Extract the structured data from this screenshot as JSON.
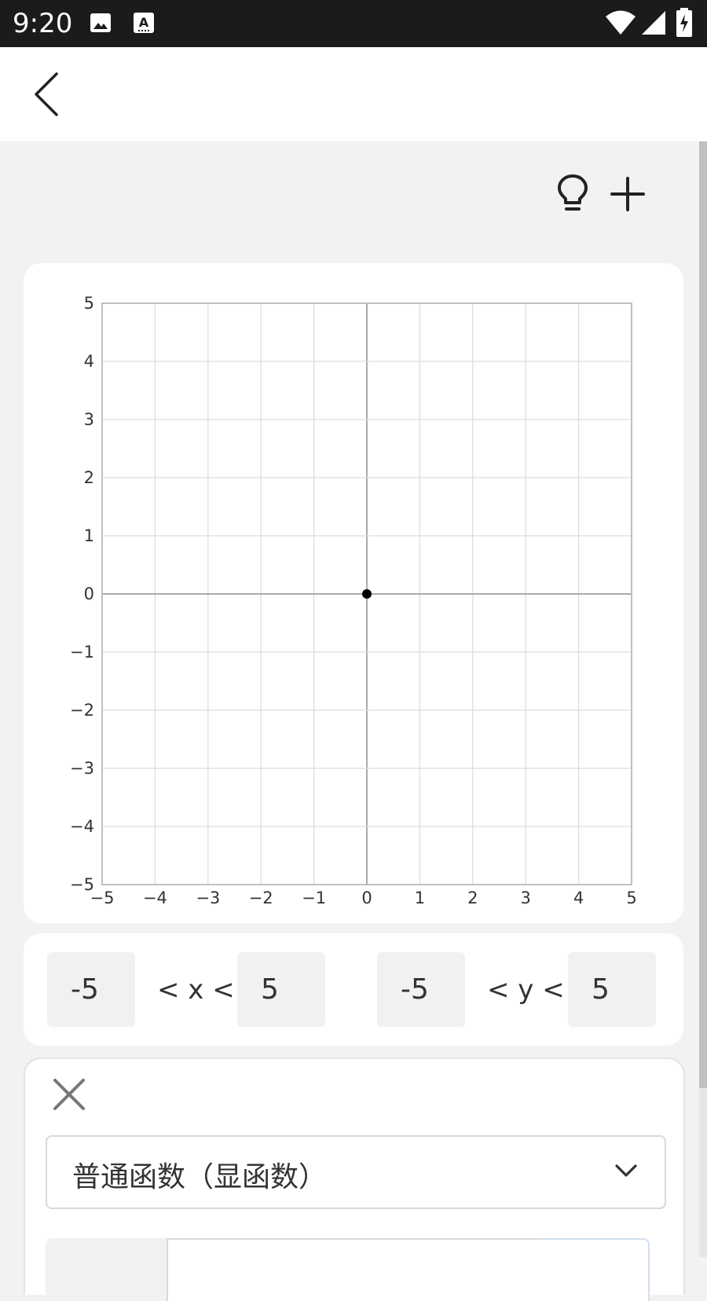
{
  "status_bar": {
    "time": "9:20",
    "icons": [
      "image-icon",
      "text-recognition-icon",
      "wifi-icon",
      "cellular-signal-icon",
      "battery-charging-icon"
    ]
  },
  "app_bar": {
    "back_icon": "chevron-left-icon"
  },
  "toolbar": {
    "hint_icon": "lightbulb-icon",
    "add_icon": "plus-icon"
  },
  "graph": {
    "chart_data": {
      "type": "scatter",
      "title": "",
      "xlabel": "",
      "ylabel": "",
      "xlim": [
        -5,
        5
      ],
      "ylim": [
        -5,
        5
      ],
      "x_ticks": [
        "−5",
        "−4",
        "−3",
        "−2",
        "−1",
        "0",
        "1",
        "2",
        "3",
        "4",
        "5"
      ],
      "y_ticks": [
        "5",
        "4",
        "3",
        "2",
        "1",
        "0",
        "−1",
        "−2",
        "−3",
        "−4",
        "−5"
      ],
      "grid": true,
      "series": [
        {
          "points": [
            {
              "x": 0,
              "y": 0
            }
          ]
        }
      ]
    }
  },
  "range": {
    "x_min": "-5",
    "x_op": "< x <",
    "x_max": "5",
    "y_min": "-5",
    "y_op": "< y <",
    "y_max": "5"
  },
  "function_panel": {
    "close_icon": "close-icon",
    "type_selected": "普通函数（显函数）",
    "dropdown_icon": "chevron-down-icon"
  },
  "colors": {
    "status_bar_bg": "#1b1b1b",
    "page_bg": "#f2f2f2",
    "card_bg": "#ffffff",
    "grid": "#dddddd",
    "axis": "#aaaaaa",
    "point": "#000000"
  }
}
